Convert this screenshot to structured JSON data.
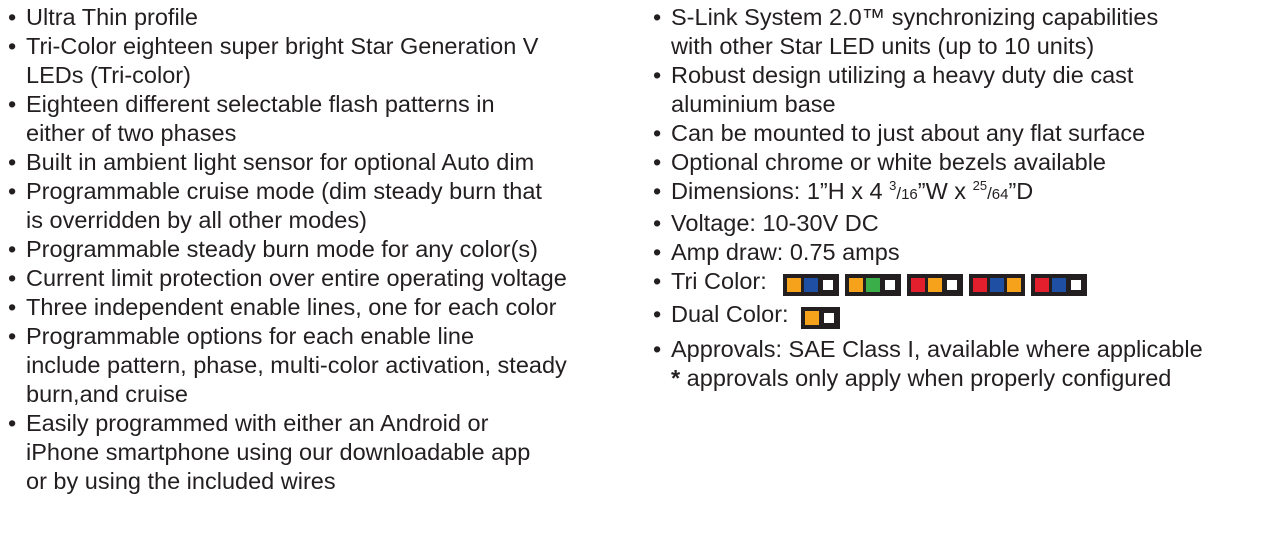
{
  "left_features": [
    "Ultra Thin profile",
    "Tri-Color eighteen super bright Star Generation V LEDs (Tri-color)",
    "Eighteen different selectable flash patterns in either of two phases",
    "Built in ambient light sensor for optional Auto dim",
    "Programmable cruise mode (dim steady burn that is overridden by all other modes)",
    "Programmable steady burn mode for any color(s)",
    "Current limit protection over entire operating voltage",
    "Three independent enable lines, one for each color",
    "Programmable options for each enable line include pattern, phase, multi-color activation, steady burn,and cruise",
    "Easily programmed with either an Android or iPhone smartphone using our downloadable app or by using the included wires"
  ],
  "left_lines": [
    [
      "Ultra Thin profile"
    ],
    [
      "Tri-Color eighteen super bright Star Generation V",
      "LEDs (Tri-color)"
    ],
    [
      "Eighteen different selectable flash patterns in",
      "either of two phases"
    ],
    [
      "Built in ambient light sensor for optional Auto dim"
    ],
    [
      "Programmable cruise mode (dim steady burn that",
      "is overridden by all other modes)"
    ],
    [
      "Programmable steady burn mode for any color(s)"
    ],
    [
      "Current limit protection over entire operating voltage"
    ],
    [
      "Three independent enable lines, one for each color"
    ],
    [
      "Programmable options for each enable line",
      "include pattern, phase, multi-color activation, steady",
      "burn,and cruise"
    ],
    [
      "Easily programmed with either an Android or",
      "iPhone smartphone using our downloadable app",
      "or by using the included wires"
    ]
  ],
  "right": {
    "slink": [
      "S-Link System 2.0™ synchronizing capabilities",
      "with other Star LED units (up to 10 units)"
    ],
    "robust": [
      "Robust design utilizing a heavy duty die cast",
      "aluminium base"
    ],
    "mount": "Can be mounted to just about any flat surface",
    "bezels": "Optional chrome or white bezels available",
    "dimensions": {
      "prefix": "Dimensions: 1”H x 4 ",
      "frac1_num": "3",
      "frac1_den": "16",
      "mid": "”W x ",
      "frac2_num": "25",
      "frac2_den": "64",
      "suffix": "”D"
    },
    "voltage": "Voltage: 10-30V DC",
    "amp": "Amp draw: 0.75 amps",
    "tri_color_label": "Tri Color:",
    "dual_color_label": "Dual Color:",
    "approvals": "Approvals: SAE Class I, available where applicable",
    "footnote_star": "*",
    "footnote": " approvals only apply when properly configured"
  },
  "colors": {
    "amber": "#f7a21b",
    "blue": "#1f4fa3",
    "green": "#3aae49",
    "red": "#e31e2d",
    "white": "#ffffff",
    "outline": "#231f20"
  },
  "tri_color_options": [
    [
      "amber",
      "blue",
      "white"
    ],
    [
      "amber",
      "green",
      "white"
    ],
    [
      "red",
      "amber",
      "white"
    ],
    [
      "red",
      "blue",
      "amber"
    ],
    [
      "red",
      "blue",
      "white"
    ]
  ],
  "dual_color_options": [
    [
      "amber",
      "white"
    ]
  ]
}
